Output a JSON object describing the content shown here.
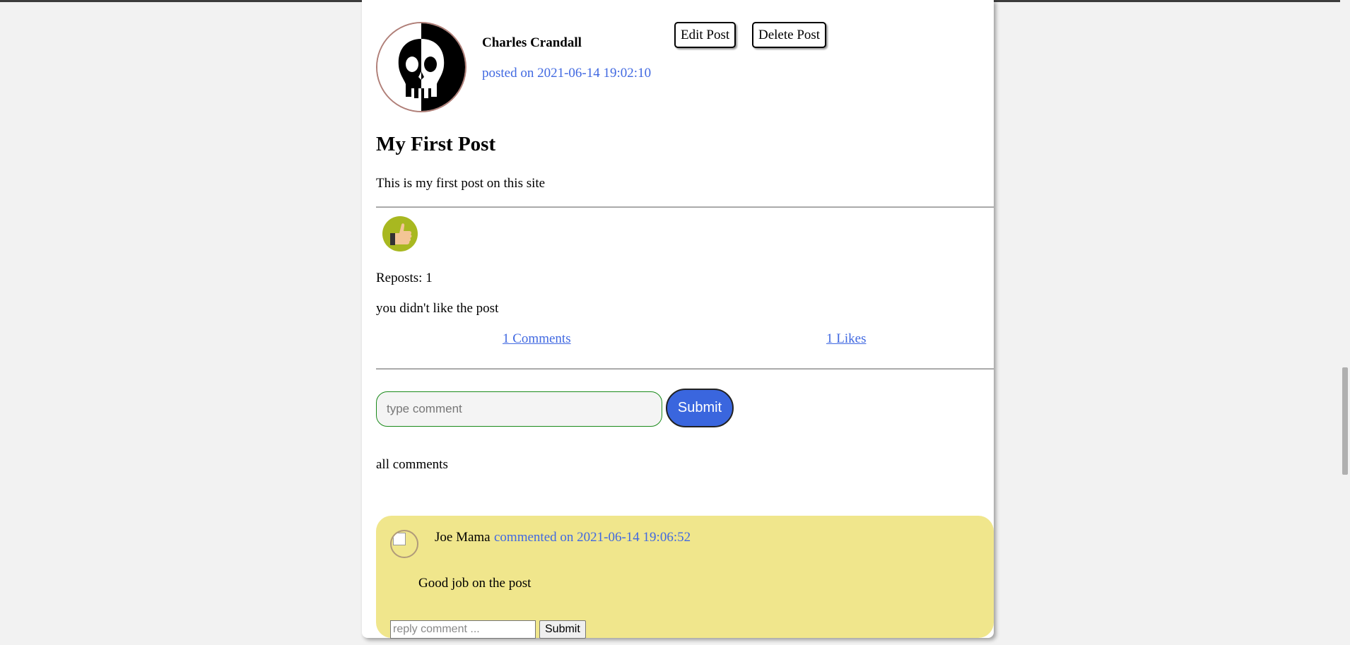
{
  "post": {
    "author": "Charles Crandall",
    "posted": "posted on 2021-06-14 19:02:10",
    "edit_label": "Edit Post",
    "delete_label": "Delete Post",
    "title": "My First Post",
    "content": "This is my first post on this site",
    "reposts": "Reposts: 1",
    "like_status": "you didn't like the post",
    "comments_link": "1 Comments",
    "likes_link": "1 Likes"
  },
  "comment_form": {
    "placeholder": "type comment",
    "submit_label": "Submit"
  },
  "all_comments_label": "all comments",
  "comments": [
    {
      "author": "Joe Mama",
      "date": "commented on 2021-06-14 19:06:52",
      "text": "Good job on the post",
      "reply_placeholder": "reply comment ...",
      "reply_submit": "Submit"
    }
  ],
  "colors": {
    "link": "#4169e1",
    "submit": "#3a66de",
    "comment_bg": "#f0e68c",
    "like_icon_bg": "#a8b820"
  },
  "icons": {
    "avatar": "skull-avatar",
    "like": "thumbs-up-icon"
  }
}
